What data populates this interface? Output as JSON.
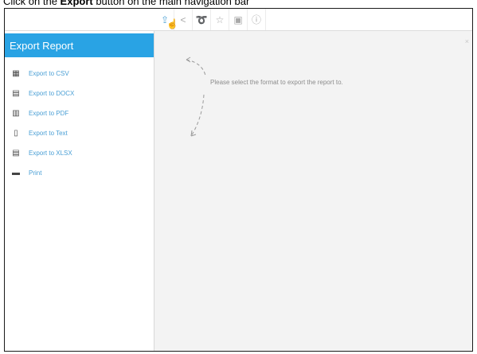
{
  "instruction": {
    "prefix": "Click on the ",
    "bold": "Export",
    "suffix": " button on the main navigation bar"
  },
  "toolbar": {
    "buttons": [
      {
        "icon": "export-icon",
        "glyph": "⇪",
        "active": true
      },
      {
        "icon": "share-icon",
        "glyph": "<"
      },
      {
        "icon": "rss-icon",
        "glyph": "➰"
      },
      {
        "icon": "star-icon",
        "glyph": "☆"
      },
      {
        "icon": "bookmark-icon",
        "glyph": "▣"
      },
      {
        "icon": "info-icon",
        "glyph": "ⓘ"
      }
    ],
    "cursor_glyph": "☝"
  },
  "sidebar": {
    "title": "Export Report",
    "items": [
      {
        "label": "Export to CSV",
        "icon": "csv-icon",
        "glyph": "▦"
      },
      {
        "label": "Export to DOCX",
        "icon": "docx-icon",
        "glyph": "▤"
      },
      {
        "label": "Export to PDF",
        "icon": "pdf-icon",
        "glyph": "▥"
      },
      {
        "label": "Export to Text",
        "icon": "text-file-icon",
        "glyph": "▯"
      },
      {
        "label": "Export to XLSX",
        "icon": "xlsx-icon",
        "glyph": "▤"
      },
      {
        "label": "Print",
        "icon": "print-icon",
        "glyph": "▬"
      }
    ]
  },
  "main": {
    "close_glyph": "×",
    "hint": "Please select the format to export the report to."
  },
  "colors": {
    "accent": "#29a3e4",
    "link": "#4a9fd5"
  }
}
